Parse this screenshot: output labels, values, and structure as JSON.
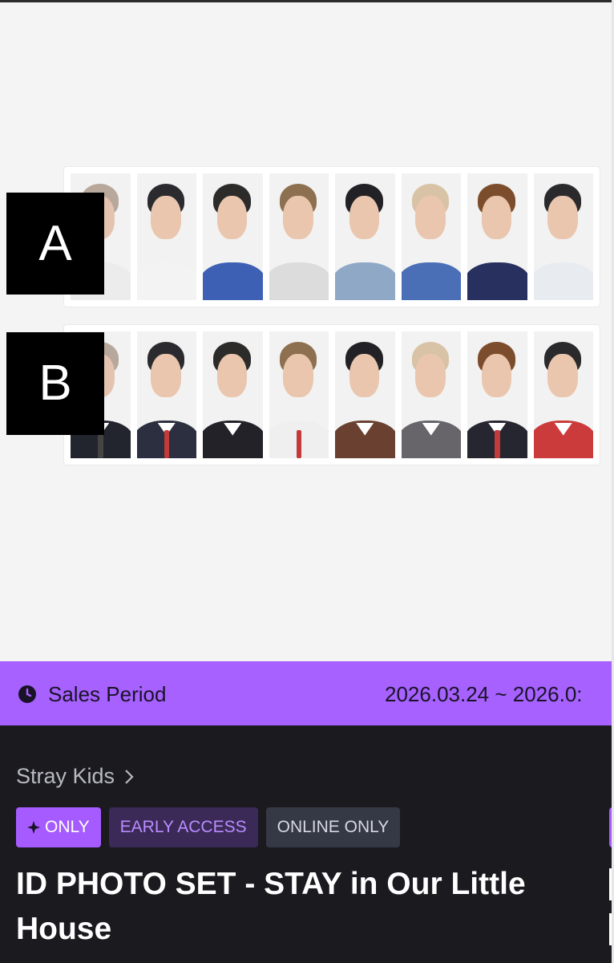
{
  "labels": {
    "a": "A",
    "b": "B"
  },
  "sales": {
    "label": "Sales Period",
    "dates": "2026.03.24 ~ 2026.0:"
  },
  "product": {
    "artist": "Stray Kids",
    "badges": {
      "only": "ONLY",
      "early": "EARLY ACCESS",
      "online": "ONLINE ONLY"
    },
    "title": "ID PHOTO SET - STAY in Our Little House"
  },
  "icons": [
    "clock-icon",
    "chevron-right-icon",
    "sparkle-icon"
  ],
  "colors": {
    "accent": "#a661ff",
    "panel_bg": "#1a1a1f",
    "badge_only": "#a55bff",
    "badge_early_bg": "#3b2a57",
    "badge_online_bg": "#353845"
  }
}
